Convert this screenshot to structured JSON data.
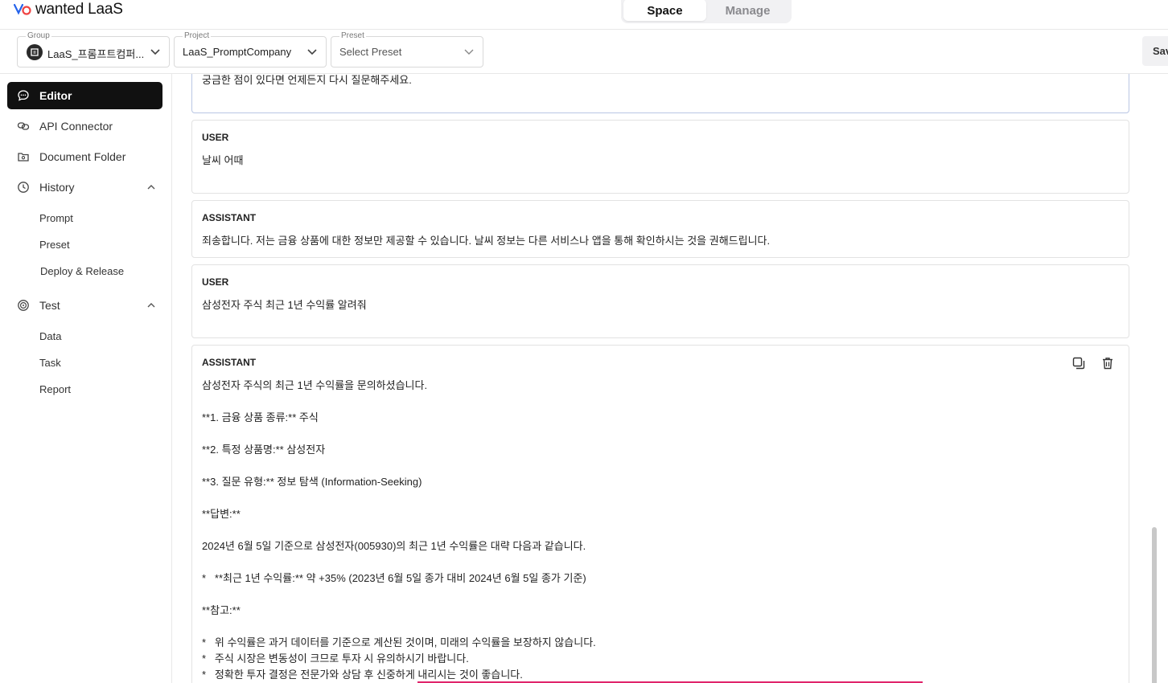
{
  "app": {
    "logo_text": "wanted LaaS"
  },
  "mode_switch": {
    "space": "Space",
    "manage": "Manage"
  },
  "selectors": {
    "group": {
      "label": "Group",
      "value": "LaaS_프롬프트컴퍼..."
    },
    "project": {
      "label": "Project",
      "value": "LaaS_PromptCompany"
    },
    "preset": {
      "label": "Preset",
      "placeholder": "Select Preset"
    },
    "save_label": "Save"
  },
  "sidebar": {
    "items": [
      {
        "label": "Editor",
        "icon": "chat-bubble-icon"
      },
      {
        "label": "API Connector",
        "icon": "link-icon"
      },
      {
        "label": "Document Folder",
        "icon": "folder-icon"
      },
      {
        "label": "History",
        "icon": "clock-icon"
      },
      {
        "label": "Test",
        "icon": "target-icon"
      }
    ],
    "history_sub": [
      "Prompt",
      "Preset",
      "Deploy & Release"
    ],
    "test_sub": [
      "Data",
      "Task",
      "Report"
    ]
  },
  "messages": [
    {
      "role": "",
      "text": "궁금한 점이 있다면 언제든지 다시 질문해주세요."
    },
    {
      "role": "USER",
      "text": "날씨 어때"
    },
    {
      "role": "ASSISTANT",
      "text": "죄송합니다. 저는 금융 상품에 대한 정보만 제공할 수 있습니다. 날씨 정보는 다른 서비스나 앱을 통해 확인하시는 것을 권해드립니다."
    },
    {
      "role": "USER",
      "text": "삼성전자 주식 최근 1년 수익률 알려줘"
    },
    {
      "role": "ASSISTANT",
      "text": "삼성전자 주식의 최근 1년 수익률을 문의하셨습니다.\n\n**1. 금융 상품 종류:** 주식\n\n**2. 특정 상품명:** 삼성전자\n\n**3. 질문 유형:** 정보 탐색 (Information-Seeking)\n\n**답변:**\n\n2024년 6월 5일 기준으로 삼성전자(005930)의 최근 1년 수익률은 대략 다음과 같습니다.\n\n*   **최근 1년 수익률:** 약 +35% (2023년 6월 5일 종가 대비 2024년 6월 5일 종가 기준)\n\n**참고:**\n\n*   위 수익률은 과거 데이터를 기준으로 계산된 것이며, 미래의 수익률을 보장하지 않습니다.\n*   주식 시장은 변동성이 크므로 투자 시 유의하시기 바랍니다.\n*   정확한 투자 결정은 전문가와 상담 후 신중하게 내리시는 것이 좋습니다."
    }
  ]
}
